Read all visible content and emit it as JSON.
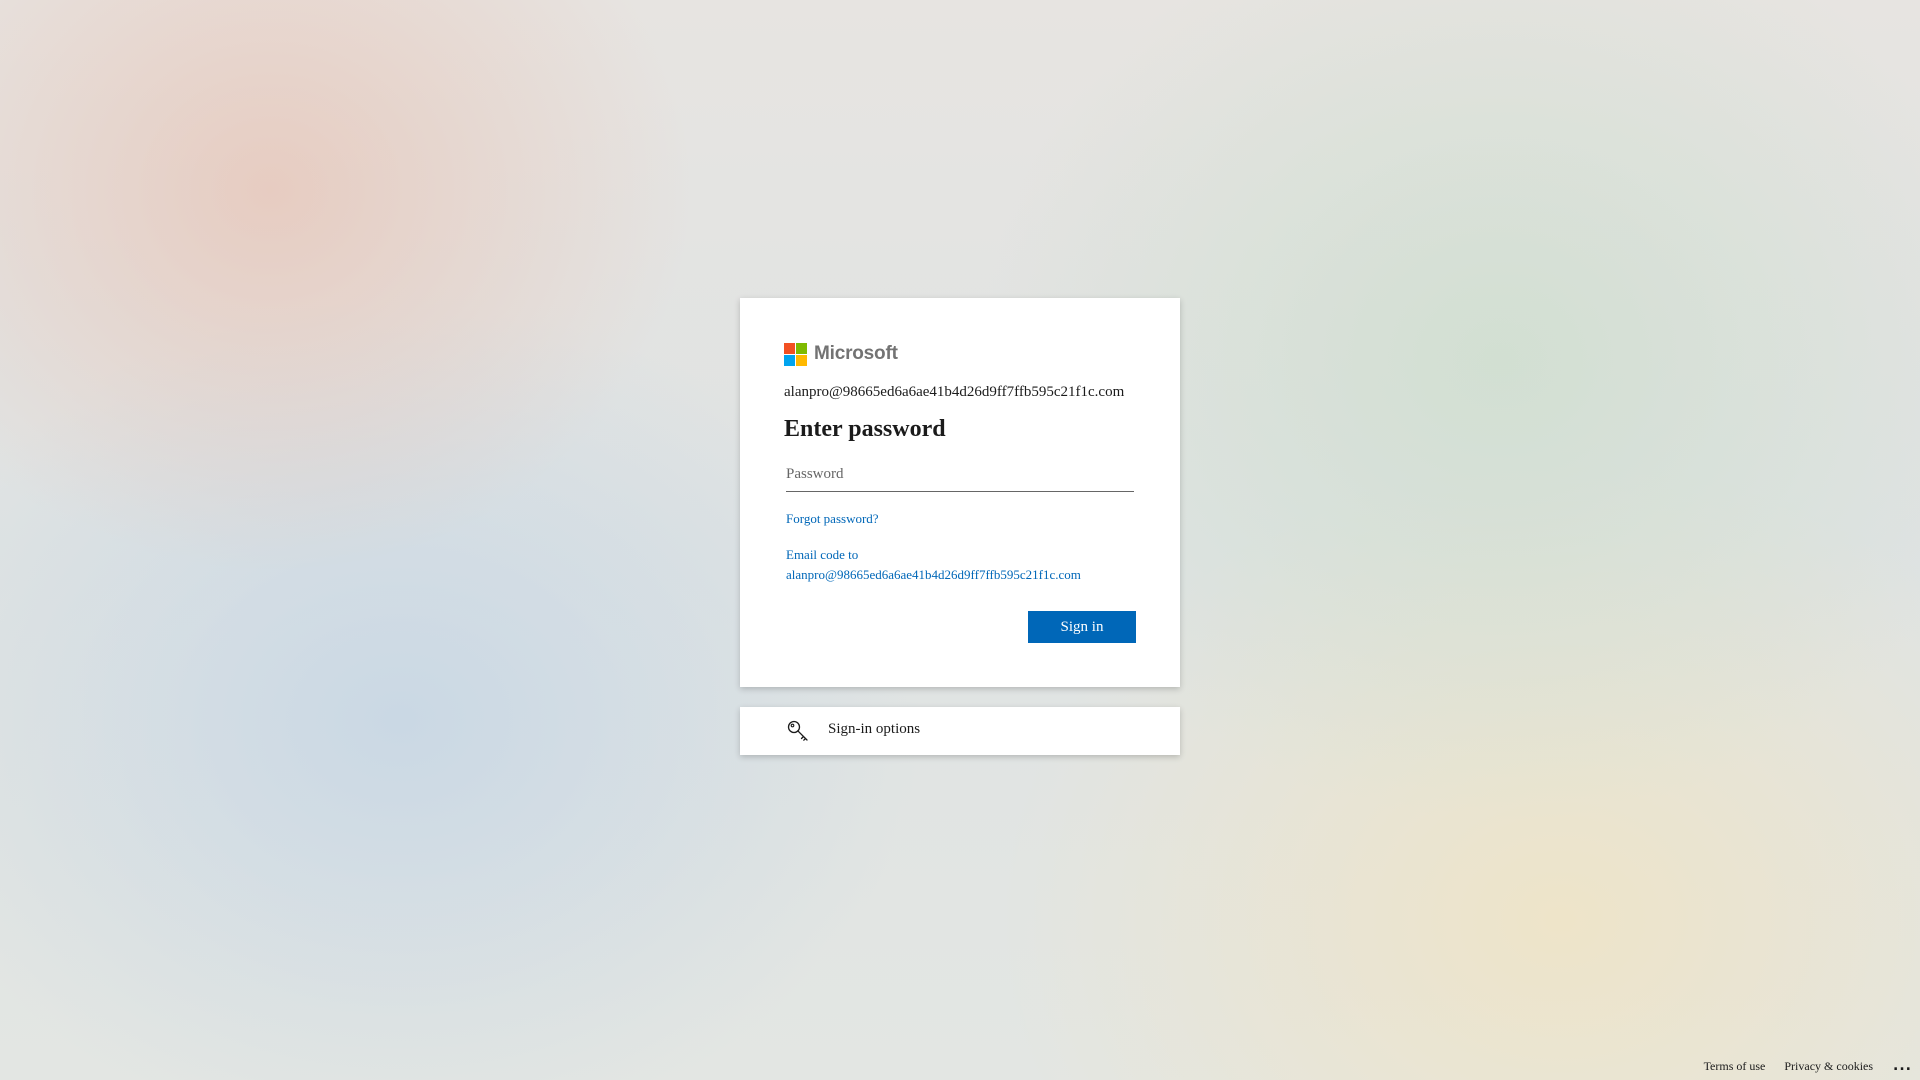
{
  "brand": {
    "name": "Microsoft",
    "logo_colors": [
      "#f25022",
      "#7fba00",
      "#00a4ef",
      "#ffb900"
    ]
  },
  "login": {
    "identity": "alanpro@98665ed6a6ae41b4d26d9ff7ffb595c21f1c.com",
    "title": "Enter password",
    "password": {
      "placeholder": "Password",
      "value": ""
    },
    "forgot_password": "Forgot password?",
    "email_code_line1": "Email code to",
    "email_code_line2": "alanpro@98665ed6a6ae41b4d26d9ff7ffb595c21f1c.com",
    "sign_in_label": "Sign in",
    "accent_color": "#0067b8"
  },
  "options": {
    "icon": "key-icon",
    "label": "Sign-in options"
  },
  "footer": {
    "terms": "Terms of use",
    "privacy": "Privacy & cookies",
    "more": "..."
  }
}
